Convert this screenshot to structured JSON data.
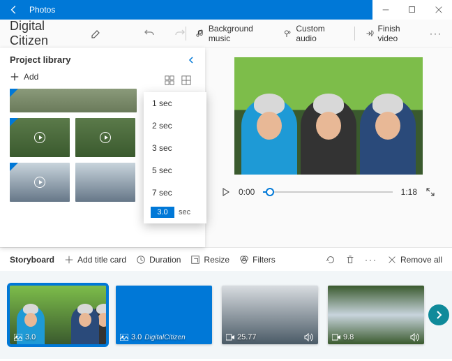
{
  "titlebar": {
    "app_name": "Photos"
  },
  "project": {
    "title": "Digital Citizen"
  },
  "toolbar": {
    "bg_music": "Background music",
    "custom_audio": "Custom audio",
    "finish": "Finish video"
  },
  "library": {
    "header": "Project library",
    "add": "Add"
  },
  "duration_menu": {
    "options": [
      "1 sec",
      "2 sec",
      "3 sec",
      "5 sec",
      "7 sec"
    ],
    "custom_value": "3.0",
    "unit": "sec"
  },
  "player": {
    "current_time": "0:00",
    "total_time": "1:18"
  },
  "storybar": {
    "label": "Storyboard",
    "add_title": "Add title card",
    "duration": "Duration",
    "resize": "Resize",
    "filters": "Filters",
    "remove_all": "Remove all"
  },
  "clips": [
    {
      "duration": "3.0",
      "type": "photo"
    },
    {
      "duration": "3.0",
      "type": "photo",
      "caption": "DigitalCitizen"
    },
    {
      "duration": "25.77",
      "type": "video"
    },
    {
      "duration": "9.8",
      "type": "video"
    }
  ]
}
